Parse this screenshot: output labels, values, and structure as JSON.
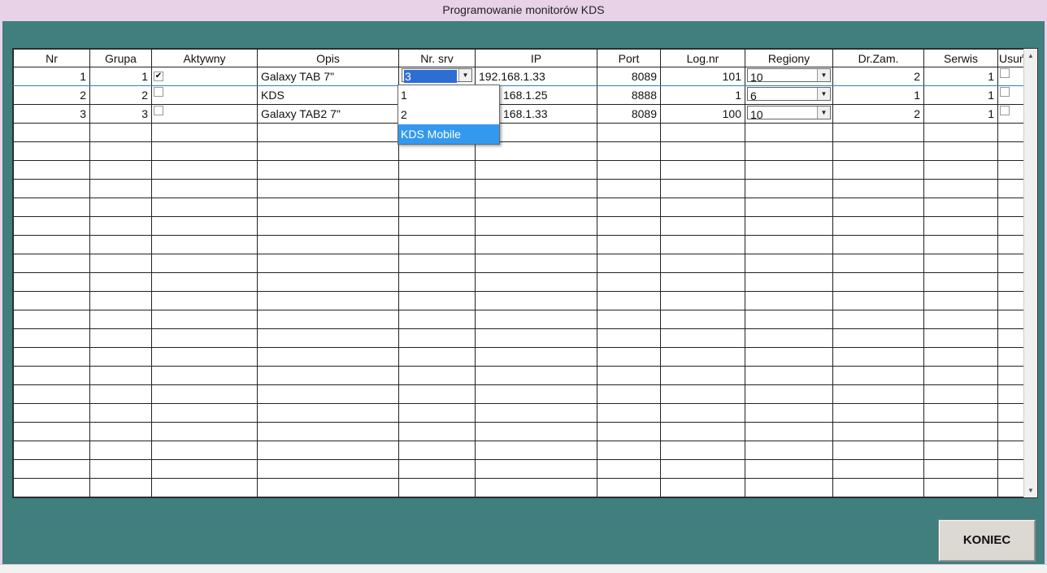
{
  "window": {
    "title": "Programowanie monitorów KDS"
  },
  "table": {
    "headers": [
      "Nr",
      "Grupa",
      "Aktywny",
      "Opis",
      "Nr. srv",
      "IP",
      "Port",
      "Log.nr",
      "Regiony",
      "Dr.Zam.",
      "Serwis",
      "Usuń"
    ],
    "rows": [
      {
        "nr": "1",
        "grupa": "1",
        "aktywny": true,
        "opis": "Galaxy TAB 7\"",
        "nr_srv": "3",
        "ip": "192.168.1.33",
        "port": "8089",
        "log_nr": "101",
        "regiony": "10",
        "dr_zam": "2",
        "serwis": "1",
        "usun": false
      },
      {
        "nr": "2",
        "grupa": "2",
        "aktywny": false,
        "opis": "KDS",
        "nr_srv": "",
        "ip": "168.1.25",
        "port": "8888",
        "log_nr": "1",
        "regiony": "6",
        "dr_zam": "1",
        "serwis": "1",
        "usun": false
      },
      {
        "nr": "3",
        "grupa": "3",
        "aktywny": false,
        "opis": "Galaxy TAB2 7\"",
        "nr_srv": "",
        "ip": "168.1.33",
        "port": "8089",
        "log_nr": "100",
        "regiony": "10",
        "dr_zam": "2",
        "serwis": "1",
        "usun": false
      }
    ],
    "empty_row_count": 20
  },
  "dropdown": {
    "options": [
      "1",
      "2",
      "KDS Mobile"
    ],
    "highlighted": "KDS Mobile"
  },
  "buttons": {
    "koniec": "KONIEC"
  },
  "icons": {
    "check": "check-icon",
    "combo_arrow": "chevron-down-icon",
    "scroll_up": "arrow-up-icon",
    "scroll_down": "arrow-down-icon"
  },
  "colors": {
    "background": "#417f7f",
    "titlebar": "#e8d2e8",
    "selection": "#3399ee"
  }
}
